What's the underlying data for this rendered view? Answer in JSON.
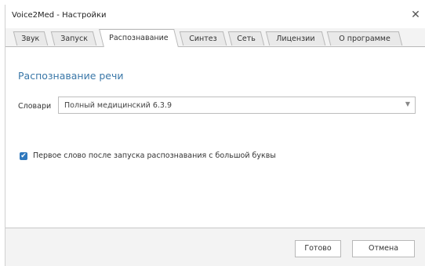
{
  "window": {
    "title": "Voice2Med - Настройки",
    "close_glyph": "✕"
  },
  "tabs": [
    {
      "label": "Звук",
      "active": false
    },
    {
      "label": "Запуск",
      "active": false
    },
    {
      "label": "Распознавание",
      "active": true
    },
    {
      "label": "Синтез",
      "active": false
    },
    {
      "label": "Сеть",
      "active": false
    },
    {
      "label": "Лицензии",
      "active": false
    },
    {
      "label": "О программе",
      "active": false
    }
  ],
  "recognition": {
    "section_title": "Распознавание речи",
    "dictionary_label": "Словари",
    "dictionary_value": "Полный медицинский 6.3.9",
    "dropdown_glyph": "▼",
    "capitalize_checkbox": {
      "checked": true,
      "check_glyph": "✔",
      "label": "Первое слово после запуска распознавания с большой буквы"
    }
  },
  "footer": {
    "done_label": "Готово",
    "cancel_label": "Отмена"
  },
  "colors": {
    "accent": "#3a77a8",
    "checkbox": "#2f78bd"
  },
  "icons": {
    "close": "close-icon",
    "dropdown": "chevron-down-icon",
    "check": "check-icon"
  }
}
